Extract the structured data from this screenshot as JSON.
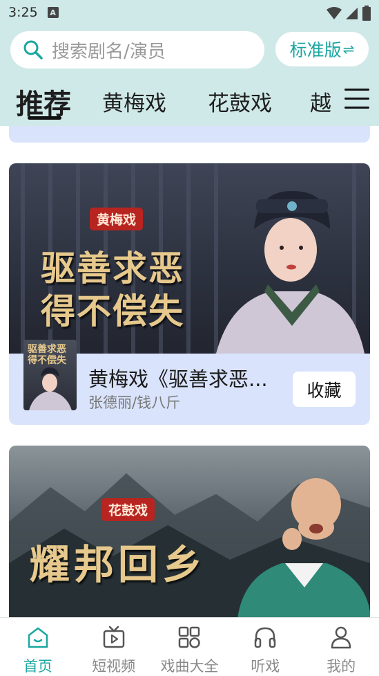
{
  "status_bar": {
    "time": "3:25",
    "notif_letter": "A"
  },
  "search": {
    "placeholder": "搜索剧名/演员"
  },
  "version_button": {
    "label": "标准版",
    "arrows": "⇌"
  },
  "tabs": [
    {
      "label": "推荐",
      "active": true
    },
    {
      "label": "黄梅戏",
      "active": false
    },
    {
      "label": "花鼓戏",
      "active": false
    },
    {
      "label": "越",
      "active": false
    }
  ],
  "cards": [
    {
      "genre": "黄梅戏",
      "art_line1": "驱善求恶",
      "art_line2": "得不偿失",
      "poster_line1": "驱善求恶",
      "poster_line2": "得不偿失",
      "title": "黄梅戏《驱善求恶...",
      "subtitle": "张德丽/钱八斤",
      "fav_label": "收藏"
    },
    {
      "genre": "花鼓戏",
      "art_line1": "耀邦回乡"
    }
  ],
  "bottom_nav": [
    {
      "label": "首页",
      "icon": "home-icon",
      "active": true
    },
    {
      "label": "短视频",
      "icon": "video-icon",
      "active": false
    },
    {
      "label": "戏曲大全",
      "icon": "grid-icon",
      "active": false
    },
    {
      "label": "听戏",
      "icon": "headphones-icon",
      "active": false
    },
    {
      "label": "我的",
      "icon": "user-icon",
      "active": false
    }
  ],
  "colors": {
    "accent": "#1aa6a0",
    "header_bg": "#cfe9e8",
    "card_bg": "#d9e3fb",
    "badge_red": "#b8241f"
  }
}
